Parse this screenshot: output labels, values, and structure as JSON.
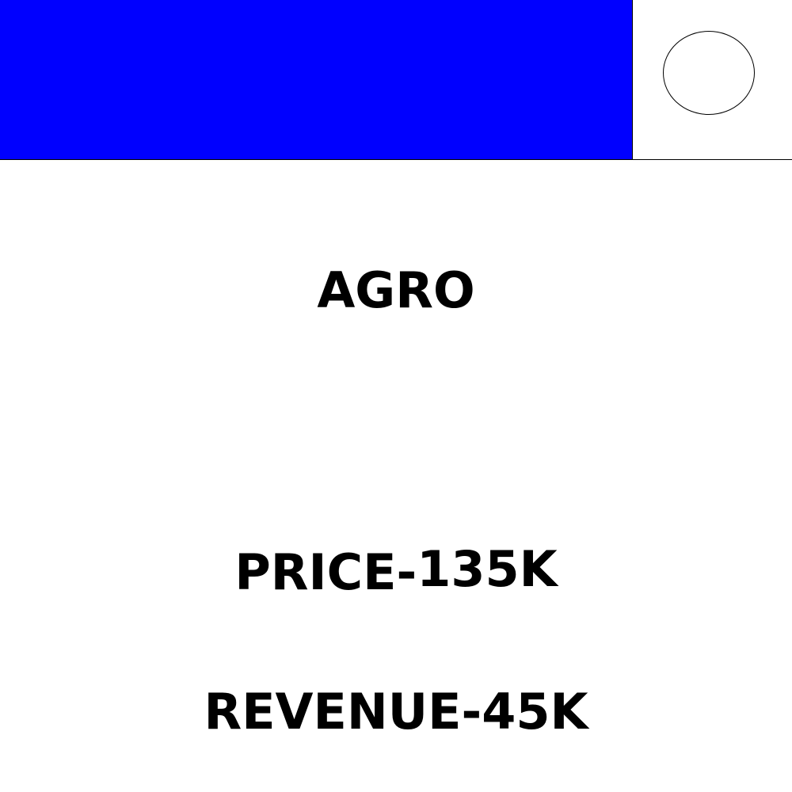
{
  "header": {
    "band_color": "#0000ff",
    "badge_icon": "circle-outline"
  },
  "card": {
    "title": "AGRO",
    "price_label": "PRICE-",
    "price_value": "135K",
    "revenue_label": "REVENUE-",
    "revenue_value": "45K"
  }
}
